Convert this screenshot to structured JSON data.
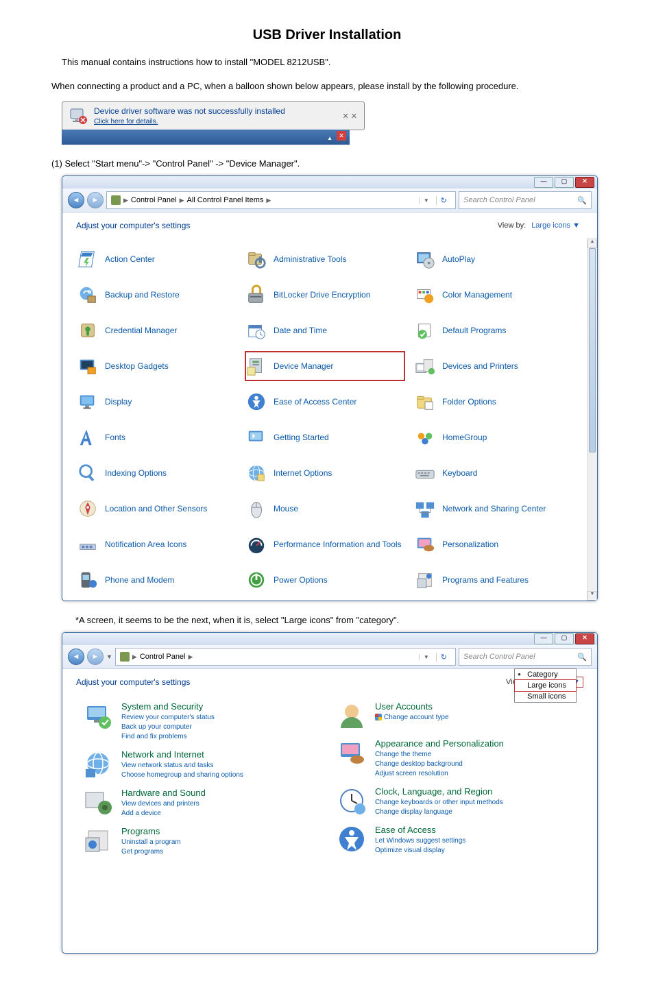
{
  "page_title": "USB Driver Installation",
  "intro": "This manual contains instructions how to install \"MODEL 8212USB\".",
  "connect_text": "When connecting a product and a PC,  when a balloon shown below appears, please install by the following procedure.",
  "balloon": {
    "title": "Device driver software was not successfully installed",
    "sub": "Click here for details."
  },
  "step1": "(1)  Select  \"Start menu\"-> \"Control Panel\" -> \"Device Manager\".",
  "note1": "*A screen, it seems to be the next, when it is, select \"Large icons\" from \"category\".",
  "win1": {
    "breadcrumb": [
      "Control Panel",
      "All Control Panel Items"
    ],
    "search_placeholder": "Search Control Panel",
    "adjust": "Adjust your computer's settings",
    "view_by_label": "View by:",
    "view_by_value": "Large icons ▼",
    "items": [
      {
        "label": "Action Center"
      },
      {
        "label": "Administrative Tools"
      },
      {
        "label": "AutoPlay"
      },
      {
        "label": "Backup and Restore"
      },
      {
        "label": "BitLocker Drive Encryption"
      },
      {
        "label": "Color Management"
      },
      {
        "label": "Credential Manager"
      },
      {
        "label": "Date and Time"
      },
      {
        "label": "Default Programs"
      },
      {
        "label": "Desktop Gadgets"
      },
      {
        "label": "Device Manager",
        "hl": true
      },
      {
        "label": "Devices and Printers"
      },
      {
        "label": "Display"
      },
      {
        "label": "Ease of Access Center"
      },
      {
        "label": "Folder Options"
      },
      {
        "label": "Fonts"
      },
      {
        "label": "Getting Started"
      },
      {
        "label": "HomeGroup"
      },
      {
        "label": "Indexing Options"
      },
      {
        "label": "Internet Options"
      },
      {
        "label": "Keyboard"
      },
      {
        "label": "Location and Other Sensors"
      },
      {
        "label": "Mouse"
      },
      {
        "label": "Network and Sharing Center"
      },
      {
        "label": "Notification Area Icons"
      },
      {
        "label": "Performance Information and Tools"
      },
      {
        "label": "Personalization"
      },
      {
        "label": "Phone and Modem"
      },
      {
        "label": "Power Options"
      },
      {
        "label": "Programs and Features"
      }
    ]
  },
  "win2": {
    "breadcrumb": [
      "Control Panel"
    ],
    "search_placeholder": "Search Control Panel",
    "adjust": "Adjust your computer's settings",
    "view_by_label": "View by:",
    "view_by_value": "Category ▼",
    "dropdown": {
      "category": "Category",
      "large": "Large icons",
      "small": "Small icons"
    },
    "left": [
      {
        "title": "System and Security",
        "links": [
          "Review your computer's status",
          "Back up your computer",
          "Find and fix problems"
        ]
      },
      {
        "title": "Network and Internet",
        "links": [
          "View network status and tasks",
          "Choose homegroup and sharing options"
        ]
      },
      {
        "title": "Hardware and Sound",
        "links": [
          "View devices and printers",
          "Add a device"
        ]
      },
      {
        "title": "Programs",
        "links": [
          "Uninstall a program",
          "Get programs"
        ]
      }
    ],
    "right": [
      {
        "title": "User Accounts",
        "links": [
          {
            "t": "Change account type",
            "s": true
          }
        ]
      },
      {
        "title": "Appearance and Personalization",
        "links": [
          {
            "t": "Change the theme"
          },
          {
            "t": "Change desktop background"
          },
          {
            "t": "Adjust screen resolution"
          }
        ]
      },
      {
        "title": "Clock, Language, and Region",
        "links": [
          {
            "t": "Change keyboards or other input methods"
          },
          {
            "t": "Change display language"
          }
        ]
      },
      {
        "title": "Ease of Access",
        "links": [
          {
            "t": "Let Windows suggest settings"
          },
          {
            "t": "Optimize visual display"
          }
        ]
      }
    ]
  }
}
